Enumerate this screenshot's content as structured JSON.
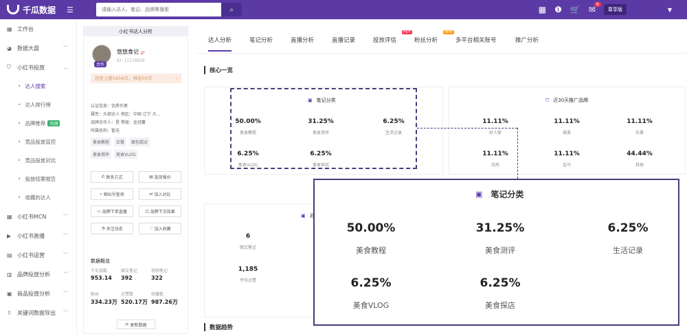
{
  "app": {
    "name": "千瓜数据"
  },
  "search": {
    "placeholder": "请输入达人、笔记、品牌等搜索"
  },
  "top_right": {
    "notification_count": "6",
    "edition": "尊享版"
  },
  "sidebar": {
    "items": [
      {
        "label": "工作台"
      },
      {
        "label": "数据大盘"
      },
      {
        "label": "小红书投放"
      },
      {
        "label": "小红书MCN"
      },
      {
        "label": "小红书直播"
      },
      {
        "label": "小红书运营"
      },
      {
        "label": "品牌投放分析"
      },
      {
        "label": "商品投放分析"
      },
      {
        "label": "关键词数据导出"
      }
    ],
    "sub_items": [
      {
        "label": "达人搜索"
      },
      {
        "label": "达人排行榜"
      },
      {
        "label": "品牌推荐",
        "tag": "内测"
      },
      {
        "label": "竞品投放监控"
      },
      {
        "label": "竞品投放对比"
      },
      {
        "label": "投放结案报告"
      },
      {
        "label": "收藏的达人"
      }
    ]
  },
  "profile": {
    "header": "小红书达人分析",
    "avatar_badge": "合作",
    "name": "悠悠食记",
    "id": "ID: 11176926",
    "history": "历史上榜1658次，排名50次",
    "info": [
      "认证信息：优质作者",
      "属性：头部达人     地区：中国 辽宁 大...",
      "品牌合作人：是       等级：金冠薯",
      "所属机构：暂无"
    ],
    "tags_row1": [
      "美食教程",
      "正餐",
      "面包甜点"
    ],
    "tags_row2": [
      "美食测评",
      "美食VLOG"
    ],
    "buttons": [
      "联系方式",
      "投放报价",
      "相似号查询",
      "加入对比",
      "品牌下单直播",
      "品牌下次效果",
      "关注动态",
      "加入收藏"
    ],
    "stats_title": "数据概览",
    "stats": [
      {
        "label": "千瓜指数",
        "value": "953.14"
      },
      {
        "label": "图文笔记",
        "value": "392"
      },
      {
        "label": "视频笔记",
        "value": "322"
      },
      {
        "label": "粉丝",
        "value": "334.23万"
      },
      {
        "label": "点赞数",
        "value": "520.17万"
      },
      {
        "label": "收藏数",
        "value": "987.26万"
      }
    ],
    "more_button": "更新数据"
  },
  "tabs": [
    {
      "label": "达人分析",
      "active": true
    },
    {
      "label": "笔记分析"
    },
    {
      "label": "直播分析"
    },
    {
      "label": "直播记录"
    },
    {
      "label": "投放评估",
      "badge": "HOT"
    },
    {
      "label": "粉丝分析",
      "badge": "NEW"
    },
    {
      "label": "多平台相关账号"
    },
    {
      "label": "推广分析"
    }
  ],
  "section_core": "核心一览",
  "section_trend": "数据趋势",
  "note_card": {
    "title": "笔记分类",
    "items": [
      {
        "value": "50.00%",
        "label": "美食教程"
      },
      {
        "value": "31.25%",
        "label": "美食测评"
      },
      {
        "value": "6.25%",
        "label": "生活记录"
      },
      {
        "value": "6.25%",
        "label": "美食VLOG"
      },
      {
        "value": "6.25%",
        "label": "美食探店"
      }
    ]
  },
  "brand_card": {
    "title": "近30天推广品牌",
    "items": [
      {
        "value": "11.11%",
        "label": "好人家"
      },
      {
        "value": "11.11%",
        "label": "维美"
      },
      {
        "value": "11.11%",
        "label": "乐事"
      },
      {
        "value": "11.11%",
        "label": "优彤"
      },
      {
        "value": "11.11%",
        "label": "金马"
      },
      {
        "value": "44.44%",
        "label": "其他"
      }
    ]
  },
  "third_card": {
    "title": "近",
    "items": [
      {
        "value": "6",
        "label": "图文笔记"
      },
      {
        "value": "1,185",
        "label": "平均点赞"
      }
    ]
  },
  "colors": {
    "brand": "#5b3aa6",
    "hot": "#ff3355",
    "new": "#ff9900"
  }
}
